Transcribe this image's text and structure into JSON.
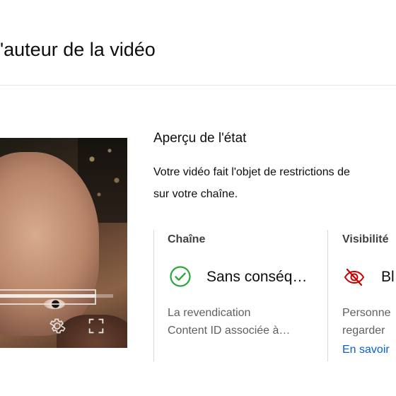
{
  "page": {
    "title": "l'auteur de la vidéo"
  },
  "player": {
    "progress_fraction": 0.85,
    "icons": [
      "settings-icon",
      "fullscreen-icon"
    ]
  },
  "status": {
    "title": "Aperçu de l'état",
    "description_line1": "Votre vidéo fait l'objet de restrictions de",
    "description_line2": "sur votre chaîne."
  },
  "columns": [
    {
      "heading": "Chaîne",
      "status_label": "Sans conséq…",
      "status_icon": "check-circle-icon",
      "status_color": "#2ba640",
      "detail_line1": "La revendication",
      "detail_line2": "Content ID associée à…"
    },
    {
      "heading": "Visibilité",
      "status_label": "Bl",
      "status_icon": "eye-off-icon",
      "status_color": "#cc0000",
      "detail_line1": "Personne",
      "detail_line2": "regarder",
      "link_label": "En savoir"
    }
  ]
}
